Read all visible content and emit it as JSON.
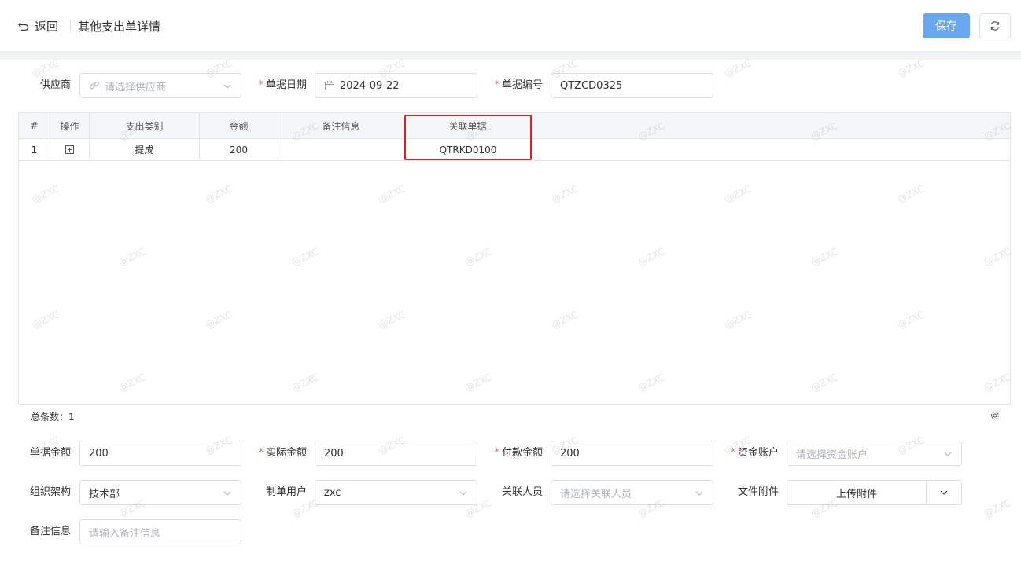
{
  "header": {
    "back_label": "返回",
    "title": "其他支出单详情",
    "save_label": "保存"
  },
  "form_top": {
    "supplier_label": "供应商",
    "supplier_placeholder": "请选择供应商",
    "date_label": "单据日期",
    "date_value": "2024-09-22",
    "code_label": "单据编号",
    "code_value": "QTZCD0325"
  },
  "table": {
    "columns": [
      "#",
      "操作",
      "支出类别",
      "金额",
      "备注信息",
      "关联单据"
    ],
    "rows": [
      {
        "index": "1",
        "category": "提成",
        "amount": "200",
        "remark": "",
        "related": "QTRKD0100"
      }
    ],
    "total_label": "总条数：1"
  },
  "form_bottom": {
    "doc_amount_label": "单据金额",
    "doc_amount_value": "200",
    "actual_amount_label": "实际金额",
    "actual_amount_value": "200",
    "pay_amount_label": "付款金额",
    "pay_amount_value": "200",
    "account_label": "资金账户",
    "account_placeholder": "请选择资金账户",
    "org_label": "组织架构",
    "org_value": "技术部",
    "creator_label": "制单用户",
    "creator_value": "zxc",
    "related_person_label": "关联人员",
    "related_person_placeholder": "请选择关联人员",
    "attach_label": "文件附件",
    "upload_label": "上传附件",
    "remark_label": "备注信息",
    "remark_placeholder": "请输入备注信息"
  },
  "watermark": "@ZXC",
  "colors": {
    "primary": "#6ba7ef",
    "required": "#f56c6c",
    "highlight": "#e02020"
  }
}
